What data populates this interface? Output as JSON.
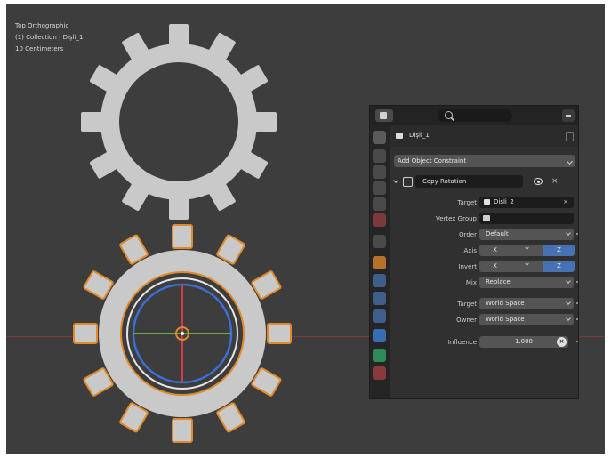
{
  "viewport": {
    "info_lines": [
      "Top Orthographic",
      "(1) Collection | Dişli_1",
      "10 Centimeters"
    ]
  },
  "panel": {
    "object_name": "Dişli_1",
    "add_constraint_label": "Add Object Constraint",
    "constraint": {
      "name": "Copy Rotation",
      "close_symbol": "×",
      "rows": {
        "target_label": "Target",
        "target_value": "Dişli_2",
        "target_clear": "×",
        "vertex_group_label": "Vertex Group",
        "order_label": "Order",
        "order_value": "Default",
        "axis_label": "Axis",
        "axis_options": [
          "X",
          "Y",
          "Z"
        ],
        "invert_label": "Invert",
        "invert_options": [
          "X",
          "Y",
          "Z"
        ],
        "mix_label": "Mix",
        "mix_value": "Replace",
        "space_target_label": "Target",
        "space_target_value": "World Space",
        "space_owner_label": "Owner",
        "space_owner_value": "World Space",
        "influence_label": "Influence",
        "influence_value": "1.000"
      }
    }
  },
  "colors": {
    "viewport_bg": "#3d3d3d",
    "gear": "#c9c9c9",
    "selection_outline": "#e08a2a",
    "toggle_active": "#4672b4",
    "x_axis": "#7a3b3b"
  }
}
